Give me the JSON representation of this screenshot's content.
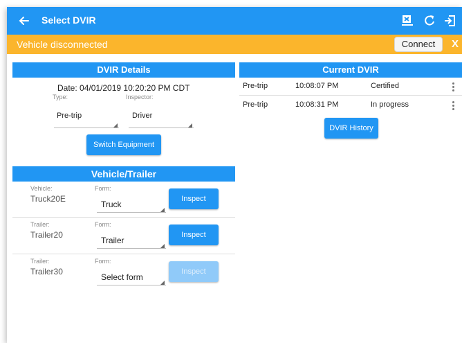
{
  "appbar": {
    "title": "Select DVIR",
    "icons": [
      "back-arrow-icon",
      "truck-disconnected-icon",
      "refresh-icon",
      "logout-icon"
    ]
  },
  "banner": {
    "message": "Vehicle disconnected",
    "connect_label": "Connect",
    "close_label": "X"
  },
  "dvir_details": {
    "header": "DVIR Details",
    "date_text": "Date: 04/01/2019 10:20:20 PM CDT",
    "type_label": "Type:",
    "type_value": "Pre-trip",
    "inspector_label": "Inspector:",
    "inspector_value": "Driver",
    "switch_button": "Switch Equipment"
  },
  "vehicle_trailer": {
    "header": "Vehicle/Trailer",
    "form_label": "Form:",
    "inspect_label": "Inspect",
    "rows": [
      {
        "type_label": "Vehicle:",
        "name": "Truck20E",
        "form": "Truck",
        "inspect_enabled": true
      },
      {
        "type_label": "Trailer:",
        "name": "Trailer20",
        "form": "Trailer",
        "inspect_enabled": true
      },
      {
        "type_label": "Trailer:",
        "name": "Trailer30",
        "form": "Select form",
        "inspect_enabled": false
      }
    ]
  },
  "current_dvir": {
    "header": "Current DVIR",
    "rows": [
      {
        "type": "Pre-trip",
        "time": "10:08:07 PM",
        "status": "Certified"
      },
      {
        "type": "Pre-trip",
        "time": "10:08:31 PM",
        "status": "In progress"
      }
    ],
    "history_button": "DVIR History"
  },
  "colors": {
    "primary": "#2196f3",
    "warning": "#fbb52c",
    "disabled_button": "#90caf9"
  }
}
